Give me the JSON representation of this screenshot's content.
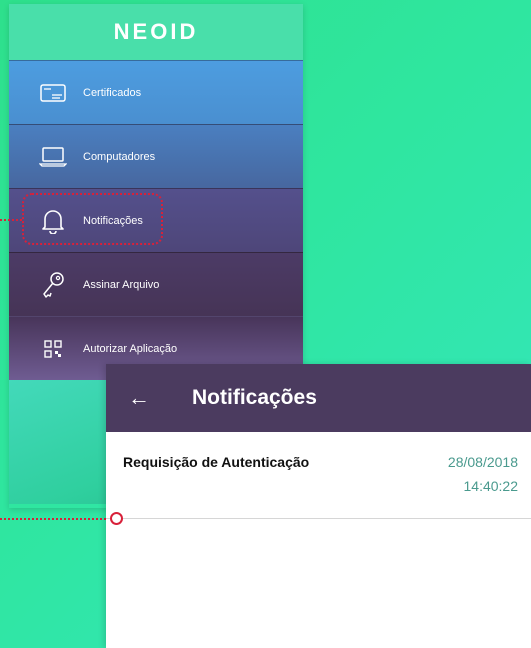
{
  "drawer": {
    "logo": "NEOID",
    "items": [
      {
        "label": "Certificados",
        "icon": "certificate-card-icon"
      },
      {
        "label": "Computadores",
        "icon": "laptop-icon"
      },
      {
        "label": "Notificações",
        "icon": "bell-icon"
      },
      {
        "label": "Assinar Arquivo",
        "icon": "keys-icon"
      },
      {
        "label": "Autorizar Aplicação",
        "icon": "qr-code-icon"
      }
    ]
  },
  "screen": {
    "back_icon": "←",
    "title": "Notificações",
    "notifications": [
      {
        "title": "Requisição de Autenticação",
        "date": "28/08/2018",
        "time": "14:40:22"
      }
    ]
  },
  "colors": {
    "highlight": "#d8213a",
    "appbar": "#4b3b5f",
    "accent_text": "#4a9a8e"
  }
}
